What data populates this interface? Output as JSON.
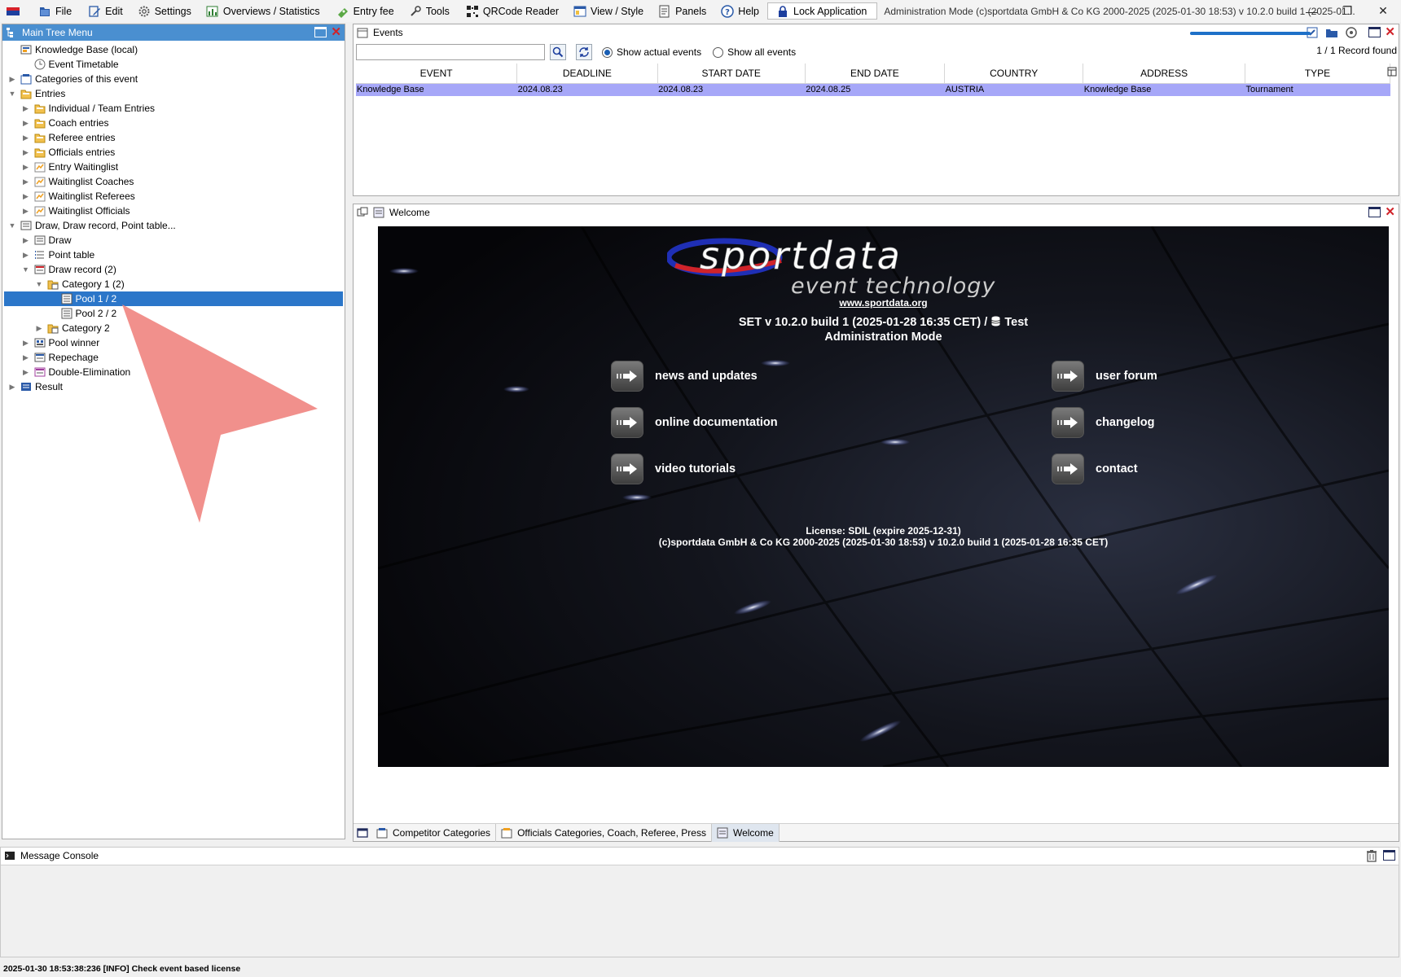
{
  "menubar": {
    "items": [
      {
        "label": "File",
        "icon": "file-icon"
      },
      {
        "label": "Edit",
        "icon": "edit-icon"
      },
      {
        "label": "Settings",
        "icon": "gear-icon"
      },
      {
        "label": "Overviews / Statistics",
        "icon": "chart-icon"
      },
      {
        "label": "Entry fee",
        "icon": "money-icon"
      },
      {
        "label": "Tools",
        "icon": "wrench-icon"
      },
      {
        "label": "QRCode Reader",
        "icon": "qrcode-icon"
      },
      {
        "label": "View / Style",
        "icon": "view-icon"
      },
      {
        "label": "Panels",
        "icon": "panels-icon"
      },
      {
        "label": "Help",
        "icon": "help-icon"
      }
    ],
    "lock_label": "Lock Application",
    "title": "Administration Mode (c)sportdata GmbH & Co KG 2000-2025 (2025-01-30 18:53)  v 10.2.0 build 1 (2025-01..."
  },
  "tree": {
    "title": "Main Tree Menu",
    "nodes": [
      {
        "label": "Knowledge Base (local)",
        "level": 0,
        "toggle": "",
        "icon": "kb-icon"
      },
      {
        "label": "Event Timetable",
        "level": 1,
        "toggle": "",
        "icon": "clock-icon"
      },
      {
        "label": "Categories of this event",
        "level": 0,
        "toggle": "▶",
        "icon": "categories-icon"
      },
      {
        "label": "Entries",
        "level": 0,
        "toggle": "▼",
        "icon": "folder-icon"
      },
      {
        "label": "Individual / Team Entries",
        "level": 1,
        "toggle": "▶",
        "icon": "folder-icon"
      },
      {
        "label": "Coach entries",
        "level": 1,
        "toggle": "▶",
        "icon": "folder-icon"
      },
      {
        "label": "Referee entries",
        "level": 1,
        "toggle": "▶",
        "icon": "folder-icon"
      },
      {
        "label": "Officials entries",
        "level": 1,
        "toggle": "▶",
        "icon": "folder-icon"
      },
      {
        "label": "Entry Waitinglist",
        "level": 1,
        "toggle": "▶",
        "icon": "waitinglist-icon"
      },
      {
        "label": "Waitinglist Coaches",
        "level": 1,
        "toggle": "▶",
        "icon": "waitinglist-icon"
      },
      {
        "label": "Waitinglist Referees",
        "level": 1,
        "toggle": "▶",
        "icon": "waitinglist-icon"
      },
      {
        "label": "Waitinglist Officials",
        "level": 1,
        "toggle": "▶",
        "icon": "waitinglist-icon"
      },
      {
        "label": "Draw, Draw record, Point table...",
        "level": 0,
        "toggle": "▼",
        "icon": "draw-icon"
      },
      {
        "label": "Draw",
        "level": 1,
        "toggle": "▶",
        "icon": "draw-icon"
      },
      {
        "label": "Point table",
        "level": 1,
        "toggle": "▶",
        "icon": "list-icon"
      },
      {
        "label": "Draw record (2)",
        "level": 1,
        "toggle": "▼",
        "icon": "draw-record-icon"
      },
      {
        "label": "Category 1 (2)",
        "level": 2,
        "toggle": "▼",
        "icon": "category-icon"
      },
      {
        "label": "Pool 1 / 2",
        "level": 3,
        "toggle": "",
        "icon": "pool-icon",
        "selected": true
      },
      {
        "label": "Pool 2 / 2",
        "level": 3,
        "toggle": "",
        "icon": "pool-icon"
      },
      {
        "label": "Category 2",
        "level": 2,
        "toggle": "▶",
        "icon": "category-icon"
      },
      {
        "label": "Pool winner",
        "level": 1,
        "toggle": "▶",
        "icon": "pool-winner-icon"
      },
      {
        "label": "Repechage",
        "level": 1,
        "toggle": "▶",
        "icon": "repechage-icon"
      },
      {
        "label": "Double-Elimination",
        "level": 1,
        "toggle": "▶",
        "icon": "double-elim-icon"
      },
      {
        "label": "Result",
        "level": 0,
        "toggle": "▶",
        "icon": "result-icon"
      }
    ]
  },
  "events": {
    "title": "Events",
    "search_value": "",
    "radio_actual": "Show actual events",
    "radio_all": "Show all events",
    "progress_fraction": 1.0,
    "record_count": "1 / 1 Record found",
    "columns": [
      "EVENT",
      "DEADLINE",
      "START DATE",
      "END DATE",
      "COUNTRY",
      "ADDRESS",
      "TYPE"
    ],
    "rows": [
      [
        "Knowledge Base",
        "2024.08.23",
        "2024.08.23",
        "2024.08.25",
        "AUSTRIA",
        "Knowledge Base",
        "Tournament"
      ]
    ]
  },
  "welcome": {
    "title": "Welcome",
    "logo_main": "sportdata",
    "logo_sub": "event technology",
    "url": "www.sportdata.org",
    "version_line": "SET v 10.2.0 build 1 (2025-01-28 16:35 CET) /",
    "db_name": "Test",
    "mode": "Administration Mode",
    "links": [
      "news and updates",
      "online documentation",
      "video tutorials",
      "user forum",
      "changelog",
      "contact"
    ],
    "license": "License: SDIL (expire 2025-12-31)",
    "copyright": "(c)sportdata GmbH & Co KG 2000-2025 (2025-01-30 18:53) v 10.2.0 build 1 (2025-01-28 16:35 CET)"
  },
  "bottom_tabs": [
    "Competitor Categories",
    "Officials Categories, Coach, Referee, Press",
    "Welcome"
  ],
  "console": {
    "title": "Message Console"
  },
  "status": "2025-01-30 18:53:38:236 [INFO] Check event based license",
  "colors": {
    "accent": "#2b76c9",
    "selected_row": "#a6a7f8",
    "close": "#d0232a"
  }
}
